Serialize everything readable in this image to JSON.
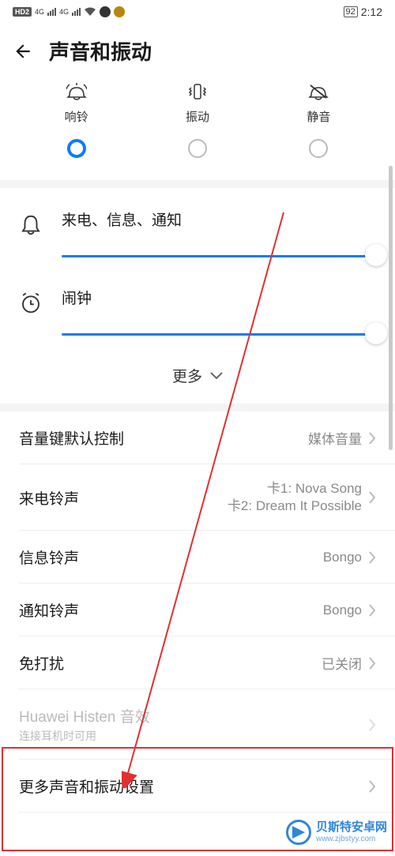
{
  "status": {
    "hd": "HD2",
    "net1": "4G",
    "net2": "4G",
    "battery": "92",
    "time": "2:12"
  },
  "header": {
    "title": "声音和振动"
  },
  "modes": {
    "ring": {
      "label": "响铃"
    },
    "vibrate": {
      "label": "振动"
    },
    "silent": {
      "label": "静音"
    }
  },
  "volumes": {
    "notification": {
      "label": "来电、信息、通知",
      "pos": 100
    },
    "alarm": {
      "label": "闹钟",
      "pos": 100
    }
  },
  "more_toggle": "更多",
  "settings": {
    "volume_key": {
      "title": "音量键默认控制",
      "value": "媒体音量"
    },
    "ringtone": {
      "title": "来电铃声",
      "line1": "卡1: Nova Song",
      "line2": "卡2: Dream It Possible"
    },
    "message": {
      "title": "信息铃声",
      "value": "Bongo"
    },
    "notification": {
      "title": "通知铃声",
      "value": "Bongo"
    },
    "dnd": {
      "title": "免打扰",
      "value": "已关闭"
    },
    "histen": {
      "title": "Huawei Histen 音效",
      "sub": "连接耳机时可用"
    },
    "more_settings": {
      "title": "更多声音和振动设置"
    }
  },
  "watermark": {
    "cn": "贝斯特安卓网",
    "url": "www.zjbstyy.com"
  }
}
